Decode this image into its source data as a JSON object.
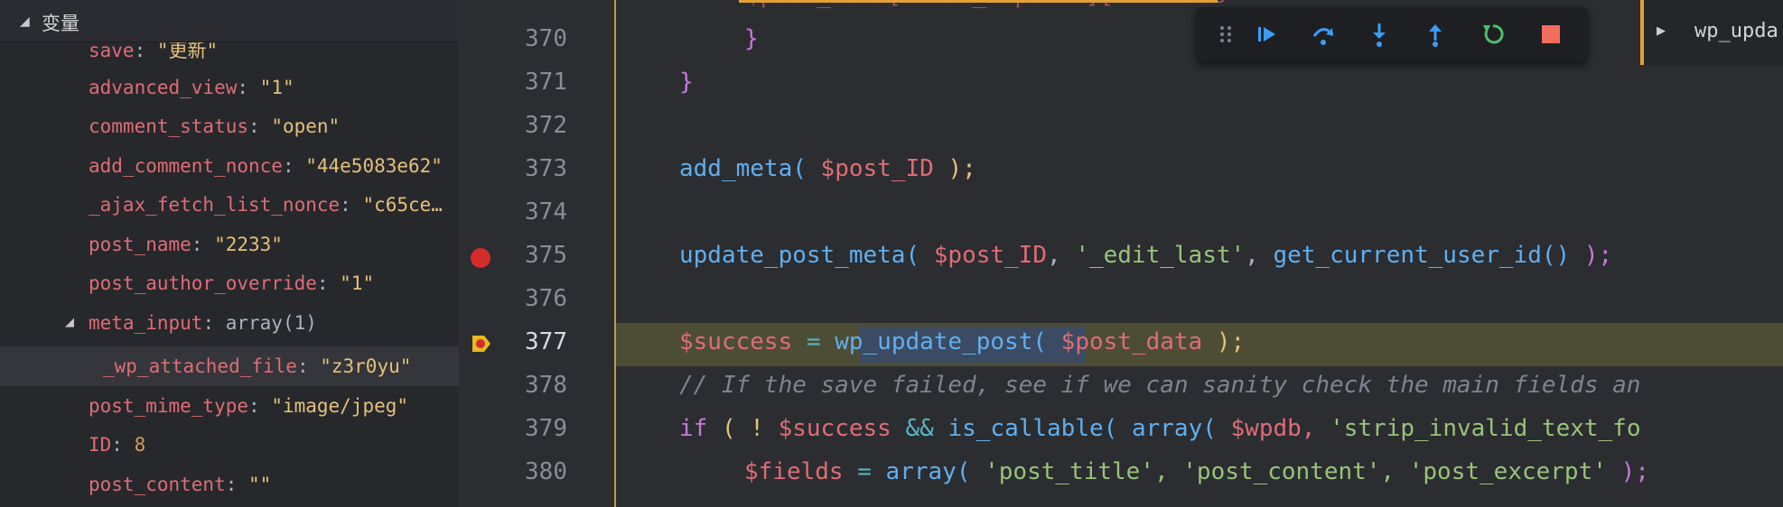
{
  "variables_panel": {
    "title": "变量",
    "rows": [
      {
        "key": "save",
        "value": "\"更新\"",
        "kind": "str"
      },
      {
        "key": "advanced_view",
        "value": "\"1\"",
        "kind": "str"
      },
      {
        "key": "comment_status",
        "value": "\"open\"",
        "kind": "str"
      },
      {
        "key": "add_comment_nonce",
        "value": "\"44e5083e62\"",
        "kind": "str"
      },
      {
        "key": "_ajax_fetch_list_nonce",
        "value": "\"c65ce…",
        "kind": "str"
      },
      {
        "key": "post_name",
        "value": "\"2233\"",
        "kind": "str"
      },
      {
        "key": "post_author_override",
        "value": "\"1\"",
        "kind": "str"
      },
      {
        "key": "meta_input",
        "value": "array(1)",
        "kind": "plain"
      },
      {
        "key": "_wp_attached_file",
        "value": "\"z3r0yu\"",
        "kind": "str"
      },
      {
        "key": "post_mime_type",
        "value": "\"image/jpeg\"",
        "kind": "str"
      },
      {
        "key": "ID",
        "value": "8",
        "kind": "num"
      },
      {
        "key": "post_content",
        "value": "\"\"",
        "kind": "str"
      }
    ]
  },
  "editor": {
    "line_numbers": [
      "370",
      "371",
      "372",
      "373",
      "374",
      "375",
      "376",
      "377",
      "378",
      "379",
      "380"
    ],
    "partial_top_line": "$post_data[ 'tax_input' ][ ... 'ns'",
    "lines": {
      "l370_brace": "}",
      "l371_brace": "}",
      "l373_fn": "add_meta(",
      "l373_var": "$post_ID",
      "l373_end": ");",
      "l375_fn": "update_post_meta(",
      "l375_var": "$post_ID",
      "l375_str": "'_edit_last'",
      "l375_fn2": "get_current_user_id()",
      "l375_end": ");",
      "l377_var": "$success",
      "l377_eq": "=",
      "l377_fn": "wp_update_post",
      "l377_paren": "(",
      "l377_arg": "$post_data",
      "l377_end": ");",
      "l378_comment": "// If the save failed, see if we can sanity check the main fields an",
      "l379_kw": "if",
      "l379_p1": "( !",
      "l379_var": "$success",
      "l379_op": "&&",
      "l379_fn": "is_callable(",
      "l379_fn2": "array(",
      "l379_var2": "$wpdb,",
      "l379_str": "'strip_invalid_text_fo",
      "l380_var": "$fields",
      "l380_eq": "=",
      "l380_fn": "array(",
      "l380_s1": "'post_title',",
      "l380_s2": "'post_content',",
      "l380_s3": "'post_excerpt'",
      "l380_end": ");"
    }
  },
  "debug_toolbar": {
    "buttons": [
      "drag-handle",
      "continue",
      "step-over",
      "step-into",
      "step-out",
      "restart",
      "stop"
    ]
  },
  "watch_panel": {
    "label": "wp_upda"
  },
  "colors": {
    "breakpoint": "#d42b2b",
    "current_line_bg": "#4d4d36",
    "accent_orange": "#e3a234"
  }
}
